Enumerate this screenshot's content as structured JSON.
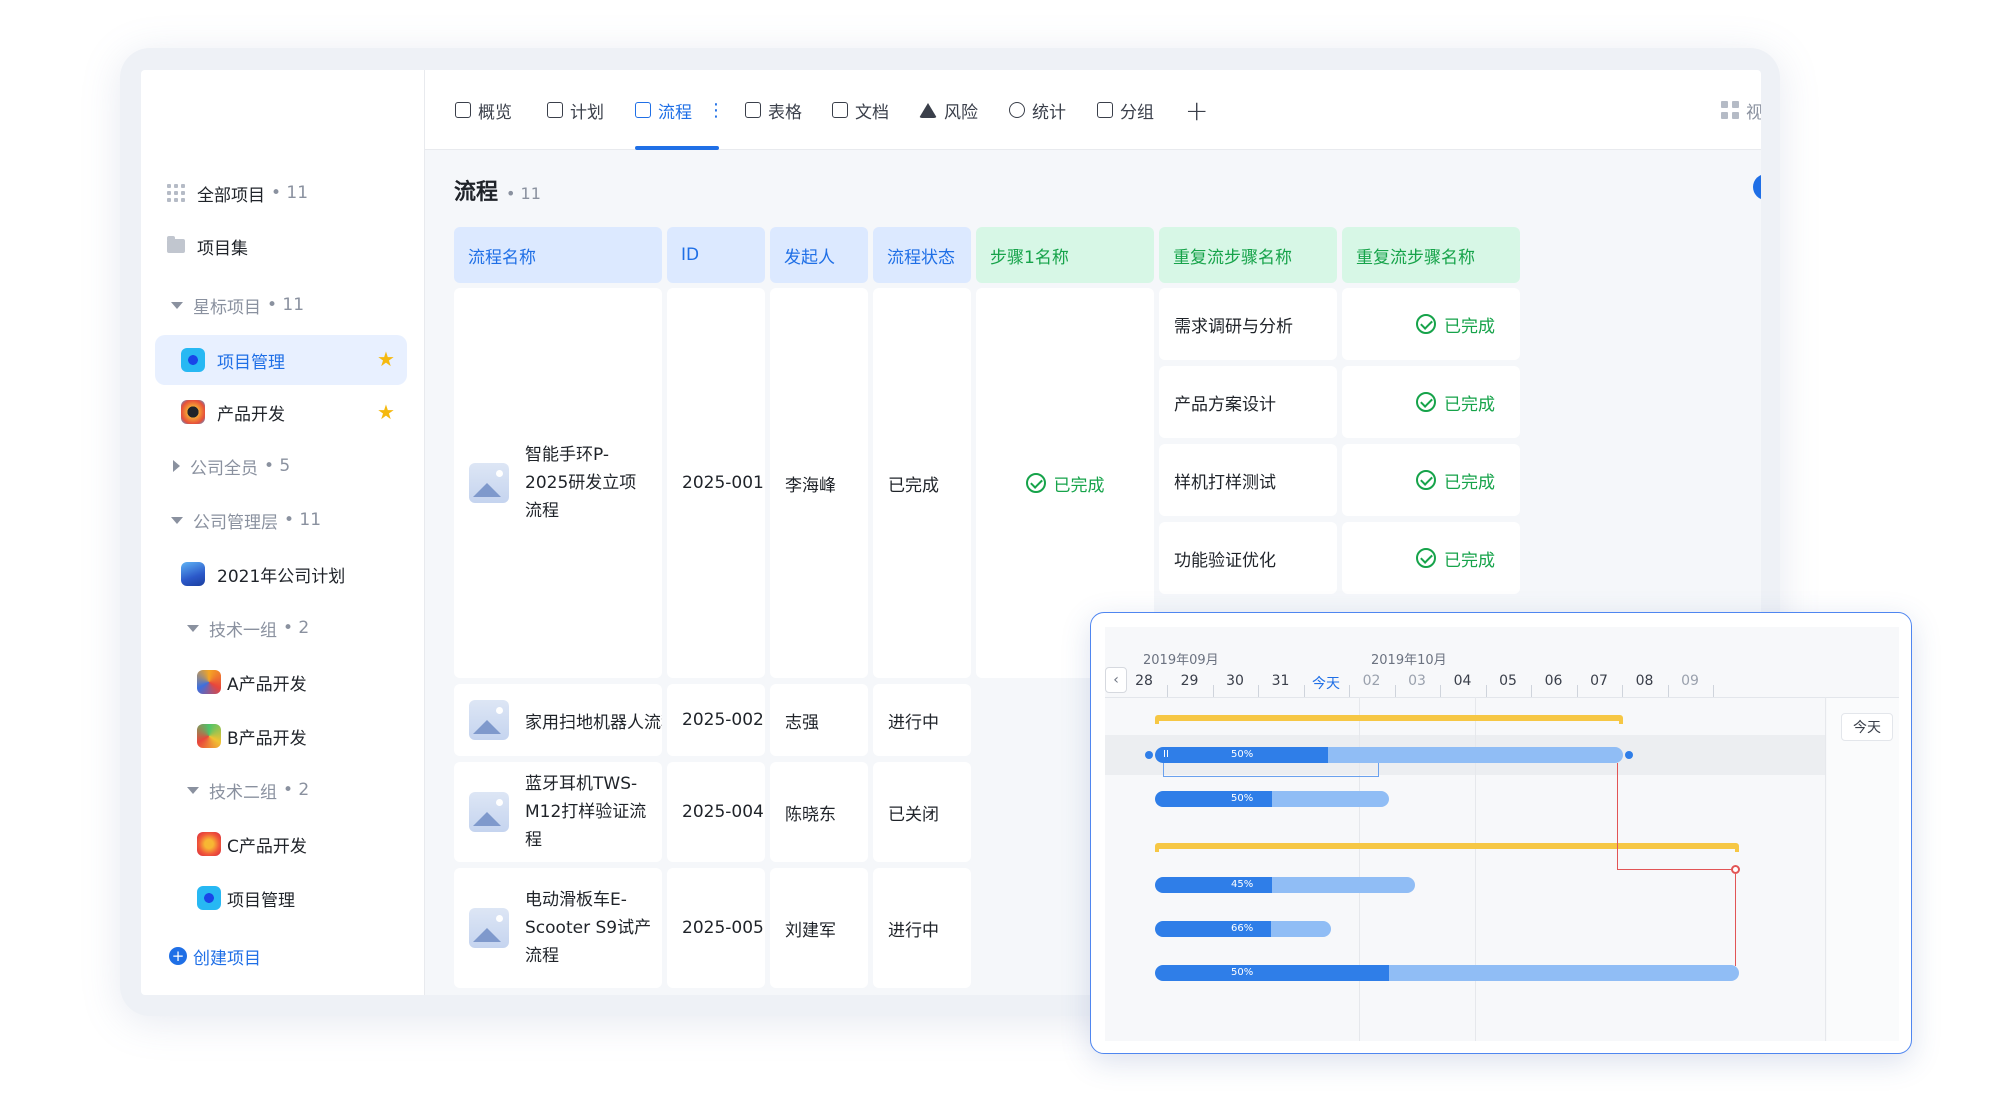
{
  "sidebar": {
    "all_projects": {
      "label": "全部项目",
      "count": "• 11"
    },
    "collections": {
      "label": "项目集"
    },
    "starred": {
      "label": "星标项目",
      "count": "• 11"
    },
    "starred_items": [
      {
        "label": "项目管理",
        "icon": "blue-circle-icon"
      },
      {
        "label": "产品开发",
        "icon": "dark-palette-icon"
      }
    ],
    "company_all": {
      "label": "公司全员",
      "count": "• 5"
    },
    "mgmt": {
      "label": "公司管理层",
      "count": "• 11"
    },
    "mgmt_plan": {
      "label": "2021年公司计划"
    },
    "tech1": {
      "label": "技术一组",
      "count": "• 2"
    },
    "tech1_items": [
      {
        "label": "A产品开发"
      },
      {
        "label": "B产品开发"
      }
    ],
    "tech2": {
      "label": "技术二组",
      "count": "• 2"
    },
    "tech2_items": [
      {
        "label": "C产品开发"
      },
      {
        "label": "项目管理"
      }
    ],
    "create": {
      "label": "创建项目"
    }
  },
  "tabs": [
    {
      "label": "概览",
      "icon": "chart-icon"
    },
    {
      "label": "计划",
      "icon": "plan-icon"
    },
    {
      "label": "流程",
      "icon": "flow-icon",
      "active": true
    },
    {
      "label": "表格",
      "icon": "table-icon"
    },
    {
      "label": "文档",
      "icon": "doc-icon"
    },
    {
      "label": "风险",
      "icon": "warning-icon"
    },
    {
      "label": "统计",
      "icon": "pie-icon"
    },
    {
      "label": "分组",
      "icon": "group-icon"
    }
  ],
  "tabs_right": {
    "label": "视"
  },
  "content": {
    "title": "流程",
    "count": "• 11"
  },
  "table": {
    "headers": [
      "流程名称",
      "ID",
      "发起人",
      "流程状态",
      "步骤1名称",
      "重复流步骤名称",
      "重复流步骤名称"
    ],
    "rows": [
      {
        "name": "智能手环P-2025研发立项流程",
        "id": "2025-001",
        "owner": "李海峰",
        "status": "已完成",
        "step1": "已完成"
      },
      {
        "name": "家用扫地机器人流程",
        "id": "2025-002",
        "owner": "志强",
        "status": "进行中"
      },
      {
        "name": "蓝牙耳机TWS-M12打样验证流程",
        "id": "2025-004",
        "owner": "陈晓东",
        "status": "已关闭"
      },
      {
        "name": "电动滑板车E-Scooter S9试产流程",
        "id": "2025-005",
        "owner": "刘建军",
        "status": "进行中"
      }
    ],
    "substeps": [
      {
        "name": "需求调研与分析",
        "state": "已完成"
      },
      {
        "name": "产品方案设计",
        "state": "已完成"
      },
      {
        "name": "样机打样测试",
        "state": "已完成"
      },
      {
        "name": "功能验证优化",
        "state": "已完成"
      }
    ]
  },
  "gantt": {
    "months": [
      "2019年09月",
      "2019年10月"
    ],
    "days": [
      "28",
      "29",
      "30",
      "31",
      "今天",
      "02",
      "03",
      "04",
      "05",
      "06",
      "07",
      "08",
      "09"
    ],
    "today_button": "今天",
    "bars": [
      {
        "percent": "50%",
        "progress": 0.37
      },
      {
        "percent": "50%",
        "progress": 0.5
      },
      {
        "percent": "45%",
        "progress": 0.45
      },
      {
        "percent": "66%",
        "progress": 0.66
      },
      {
        "percent": "50%",
        "progress": 0.4
      }
    ],
    "handle_label": "II"
  }
}
